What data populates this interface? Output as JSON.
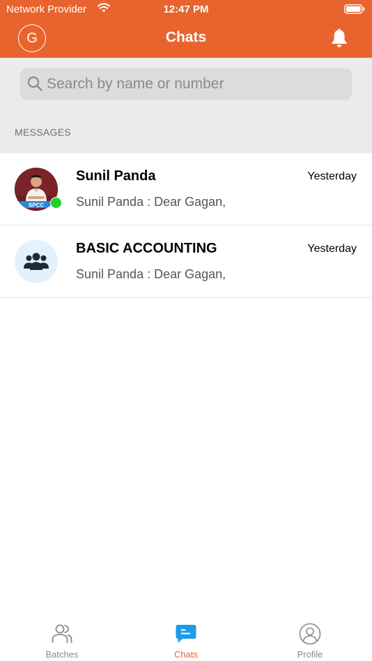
{
  "status_bar": {
    "carrier": "Network Provider",
    "time": "12:47 PM"
  },
  "header": {
    "avatar_initial": "G",
    "title": "Chats"
  },
  "search": {
    "placeholder": "Search by name or number",
    "value": ""
  },
  "section": {
    "label": "MESSAGES"
  },
  "chats": [
    {
      "name": "Sunil Panda",
      "time": "Yesterday",
      "preview": "Sunil Panda : Dear Gagan,",
      "avatar_badge": "SPCC",
      "online": true
    },
    {
      "name": "BASIC ACCOUNTING",
      "time": "Yesterday",
      "preview": "Sunil Panda : Dear Gagan,",
      "avatar_icon": "group-icon"
    }
  ],
  "tabs": [
    {
      "label": "Batches",
      "icon": "batches-icon",
      "active": false
    },
    {
      "label": "Chats",
      "icon": "chat-bubble-icon",
      "active": true
    },
    {
      "label": "Profile",
      "icon": "profile-icon",
      "active": false
    }
  ],
  "colors": {
    "brand": "#E8642E",
    "active_tab": "#E8642E",
    "chats_icon": "#1E9BE9",
    "online": "#1FD12B",
    "group_avatar_bg": "#E3F1FC"
  }
}
